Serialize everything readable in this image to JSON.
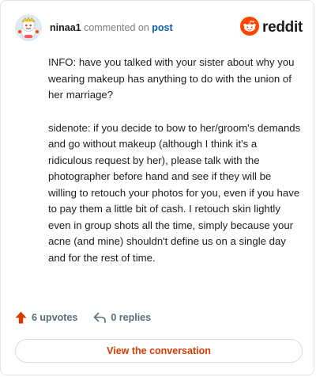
{
  "header": {
    "username": "ninaa1",
    "action_text": "commented on",
    "post_link": "post",
    "brand": "reddit"
  },
  "comment": {
    "paragraphs": [
      "INFO: have you talked with your sister about why you wearing makeup has anything to do with the union of her marriage?",
      "sidenote: if you decide to bow to her/groom's demands and go without makeup (although I think it's a ridiculous request by her), please talk with the photographer before hand and see if they will be willing to retouch your photos for you, even if you have to pay them a little bit of cash. I retouch skin lightly even in group shots all the time, simply because your acne (and mine) shouldn't define us on a single day and for the rest of time."
    ]
  },
  "actions": {
    "upvotes": "6 upvotes",
    "replies": "0 replies"
  },
  "cta": {
    "label": "View the conversation"
  },
  "colors": {
    "brand_orange": "#ff4500",
    "link_blue": "#0a5bb5",
    "cta_text": "#d93a00",
    "muted": "#576f76"
  }
}
